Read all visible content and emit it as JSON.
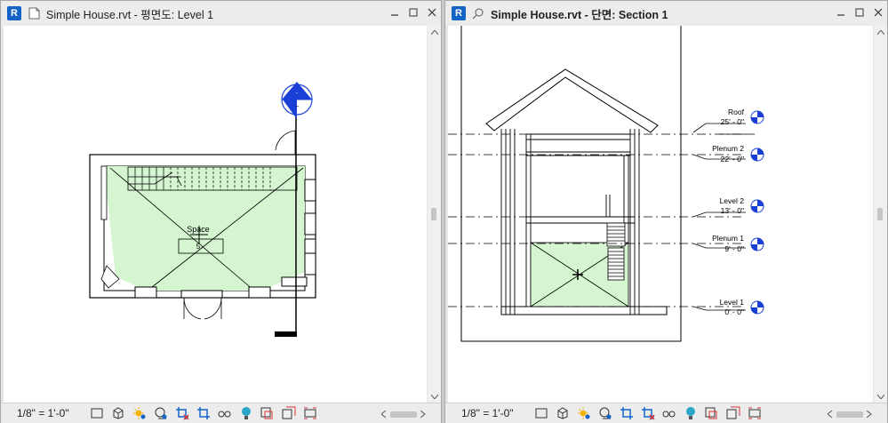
{
  "left_view": {
    "title": "Simple House.rvt - 평면도: Level 1",
    "app_icon": "R",
    "space_label": "Space",
    "space_number": "5",
    "scale": "1/8\" = 1'-0\""
  },
  "right_view": {
    "title": "Simple House.rvt - 단면: Section 1",
    "app_icon": "R",
    "scale": "1/8\" = 1'-0\"",
    "levels": [
      {
        "name": "Roof",
        "elevation": "25' - 0\""
      },
      {
        "name": "Plenum 2",
        "elevation": "22' - 0\""
      },
      {
        "name": "Level 2",
        "elevation": "13' - 0\""
      },
      {
        "name": "Plenum 1",
        "elevation": "9' - 0\""
      },
      {
        "name": "Level 1",
        "elevation": "0' - 0\""
      }
    ]
  },
  "colors": {
    "space_fill": "#d4f5d0",
    "accent_blue": "#1464c8",
    "level_head_blue": "#1a3fd6"
  },
  "view_control_icons": [
    "detail-level-icon",
    "visual-style-icon",
    "sun-path-icon",
    "shadows-icon",
    "crop-view-icon",
    "show-crop-icon",
    "unlock-3d-icon",
    "temp-hide-icon",
    "reveal-hidden-icon",
    "worksharing-icon",
    "analytical-model-icon",
    "highlight-displacement-icon"
  ]
}
